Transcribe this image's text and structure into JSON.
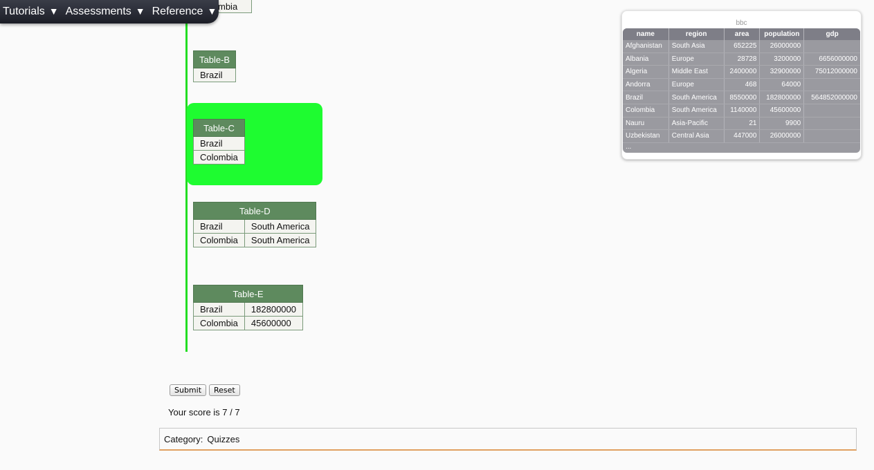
{
  "nav": {
    "items": [
      {
        "label": "Tutorials",
        "caret": "▼"
      },
      {
        "label": "Assessments",
        "caret": "▼"
      },
      {
        "label": "Reference",
        "caret": "▼"
      }
    ]
  },
  "peek_cell": "mbia",
  "tables": {
    "b": {
      "title": "Table-B",
      "rows": [
        [
          "Brazil"
        ]
      ]
    },
    "c": {
      "title": "Table-C",
      "rows": [
        [
          "Brazil"
        ],
        [
          "Colombia"
        ]
      ]
    },
    "d": {
      "title": "Table-D",
      "rows": [
        [
          "Brazil",
          "South America"
        ],
        [
          "Colombia",
          "South America"
        ]
      ]
    },
    "e": {
      "title": "Table-E",
      "rows": [
        [
          "Brazil",
          "182800000"
        ],
        [
          "Colombia",
          "45600000"
        ]
      ]
    }
  },
  "buttons": {
    "submit": "Submit",
    "reset": "Reset"
  },
  "score_text": "Your score is 7 / 7",
  "category": {
    "label": "Category:",
    "value": "Quizzes"
  },
  "bbc": {
    "caption": "bbc",
    "columns": [
      "name",
      "region",
      "area",
      "population",
      "gdp"
    ],
    "rows": [
      [
        "Afghanistan",
        "South Asia",
        "652225",
        "26000000",
        ""
      ],
      [
        "Albania",
        "Europe",
        "28728",
        "3200000",
        "6656000000"
      ],
      [
        "Algeria",
        "Middle East",
        "2400000",
        "32900000",
        "75012000000"
      ],
      [
        "Andorra",
        "Europe",
        "468",
        "64000",
        ""
      ],
      [
        "Brazil",
        "South America",
        "8550000",
        "182800000",
        "564852000000"
      ],
      [
        "Colombia",
        "South America",
        "1140000",
        "45600000",
        ""
      ],
      [
        "Nauru",
        "Asia-Pacific",
        "21",
        "9900",
        ""
      ],
      [
        "Uzbekistan",
        "Central Asia",
        "447000",
        "26000000",
        ""
      ]
    ],
    "ellipsis": "..."
  }
}
